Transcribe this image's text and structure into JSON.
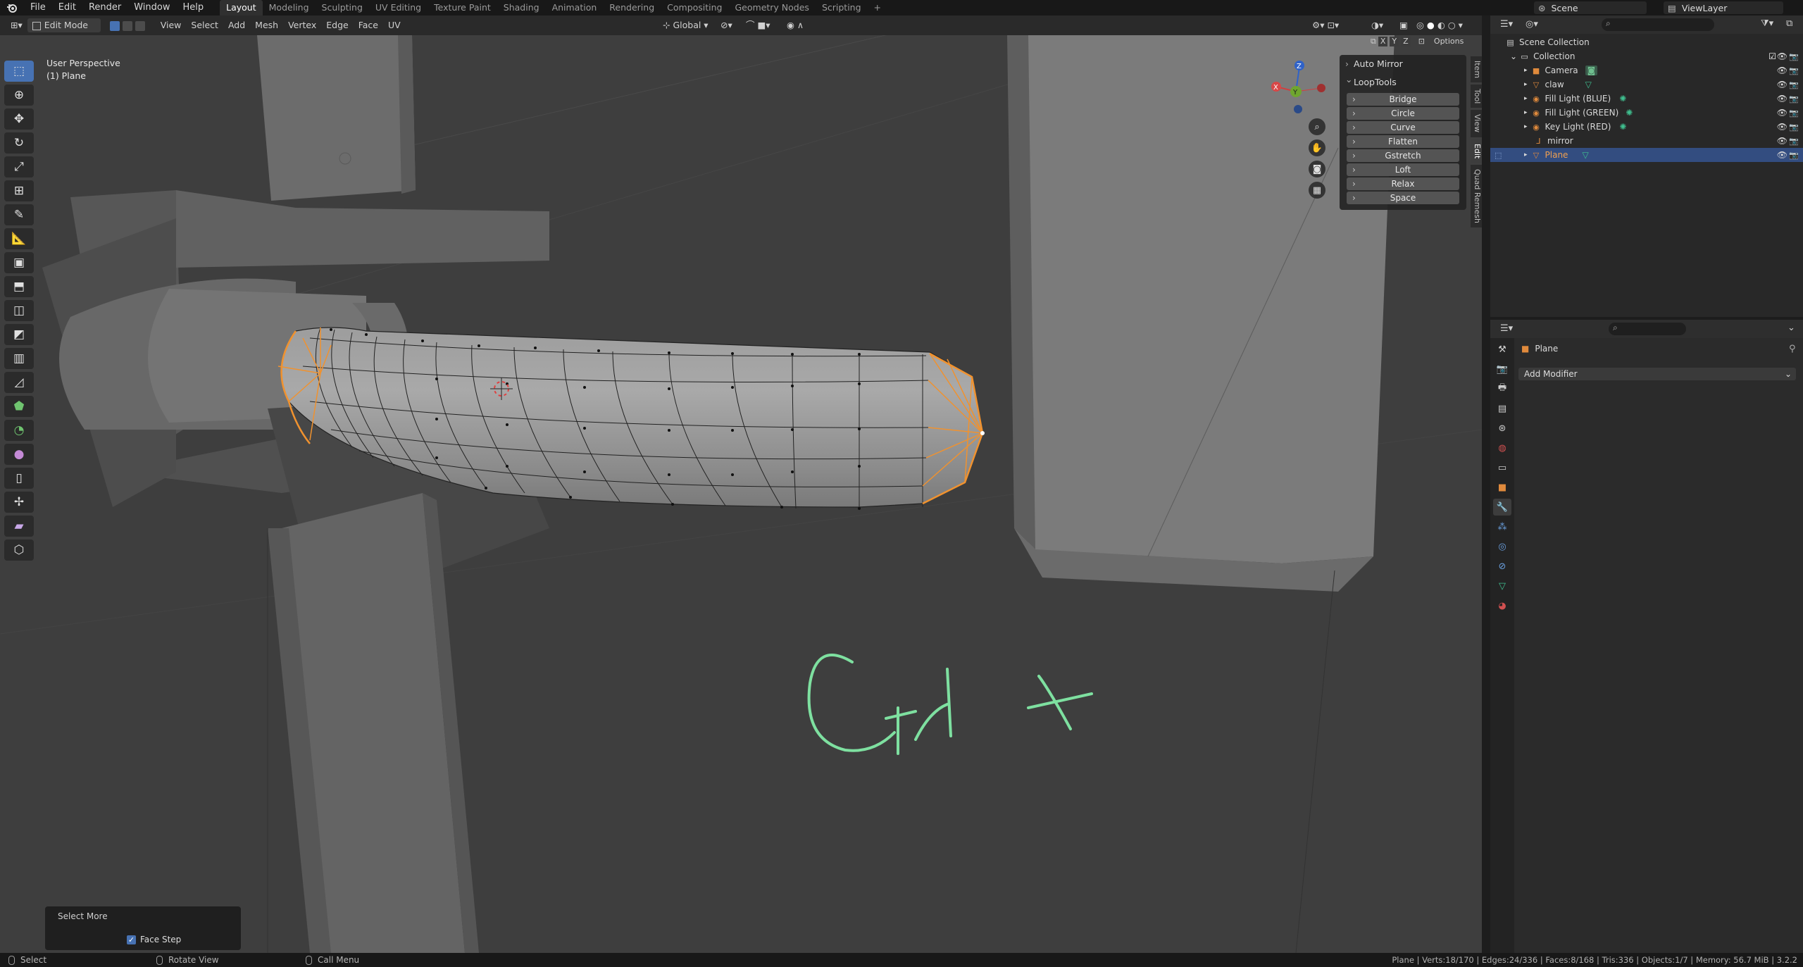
{
  "menu": {
    "items": [
      "File",
      "Edit",
      "Render",
      "Window",
      "Help"
    ],
    "workspaces": [
      "Layout",
      "Modeling",
      "Sculpting",
      "UV Editing",
      "Texture Paint",
      "Shading",
      "Animation",
      "Rendering",
      "Compositing",
      "Geometry Nodes",
      "Scripting"
    ],
    "active_workspace": "Layout",
    "add_tab": "+",
    "scene": "Scene",
    "view_layer": "ViewLayer"
  },
  "viewport_header": {
    "mode": "Edit Mode",
    "menus": [
      "View",
      "Select",
      "Add",
      "Mesh",
      "Vertex",
      "Edge",
      "Face",
      "UV"
    ],
    "transform_orientation": "Global",
    "options": "Options",
    "mirror_axes": [
      "X",
      "Y",
      "Z"
    ]
  },
  "viewport": {
    "view_name": "User Perspective",
    "object_name": "(1) Plane",
    "annotation": "Ctrl +",
    "gizmo_axes": [
      "X",
      "Y",
      "Z"
    ]
  },
  "npanel": {
    "auto_mirror": "Auto Mirror",
    "looptools": "LoopTools",
    "buttons": [
      "Bridge",
      "Circle",
      "Curve",
      "Flatten",
      "Gstretch",
      "Loft",
      "Relax",
      "Space"
    ],
    "tabs": [
      "Item",
      "Tool",
      "View",
      "Edit",
      "Quad Remesh"
    ]
  },
  "redo_panel": {
    "title": "Select More",
    "face_step": "Face Step"
  },
  "statusbar": {
    "select": "Select",
    "rotate": "Rotate View",
    "call_menu": "Call Menu",
    "stats": "Plane | Verts:18/170 | Edges:24/336 | Faces:8/168 | Tris:336 | Objects:1/7 | Memory: 56.7 MiB | 3.2.2"
  },
  "outliner": {
    "root": "Scene Collection",
    "collection": "Collection",
    "items": [
      {
        "name": "Camera",
        "icon": "camera-icon",
        "color": "#e08a3c"
      },
      {
        "name": "claw",
        "icon": "mesh-icon",
        "color": "#e08a3c"
      },
      {
        "name": "Fill Light (BLUE)",
        "icon": "light-icon",
        "color": "#e08a3c"
      },
      {
        "name": "Fill Light (GREEN)",
        "icon": "light-icon",
        "color": "#e08a3c"
      },
      {
        "name": "Key Light (RED)",
        "icon": "light-icon",
        "color": "#e08a3c"
      },
      {
        "name": "mirror",
        "icon": "empty-icon",
        "color": "#e08a3c"
      },
      {
        "name": "Plane",
        "icon": "mesh-icon",
        "color": "#e08a3c"
      }
    ],
    "selected": "Plane"
  },
  "properties": {
    "object": "Plane",
    "add_modifier": "Add Modifier"
  },
  "colors": {
    "accent": "#4772b3",
    "selection": "#e8903a",
    "annotation": "#7ee0a0"
  }
}
